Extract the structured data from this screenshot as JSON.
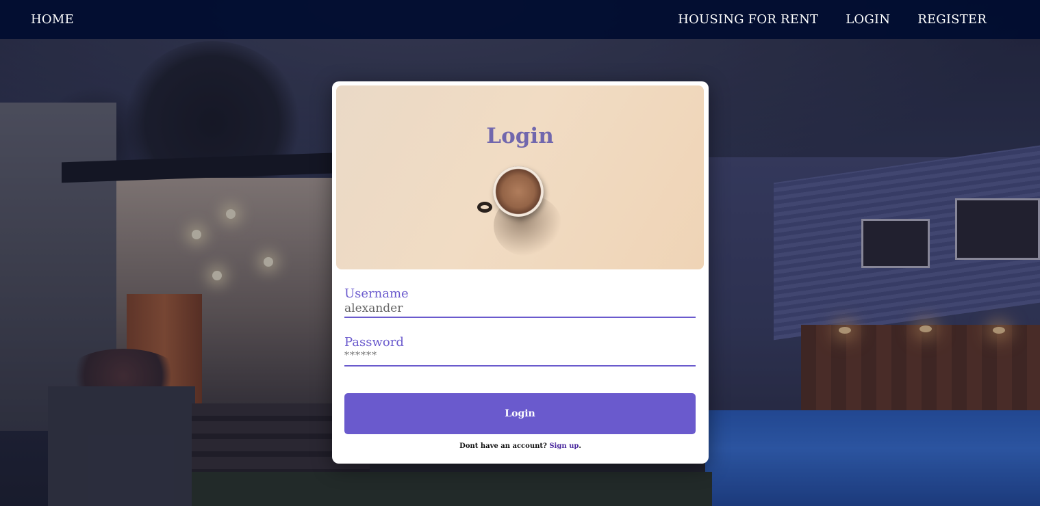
{
  "navbar": {
    "home": "HOME",
    "links": {
      "housing": "HOUSING FOR RENT",
      "login": "LOGIN",
      "register": "REGISTER"
    }
  },
  "login_card": {
    "title": "Login",
    "username": {
      "label": "Username",
      "value": "alexander"
    },
    "password": {
      "label": "Password",
      "value": "******"
    },
    "submit_label": "Login",
    "signup_prompt": "Dont have an account?",
    "signup_link": "Sign up",
    "signup_suffix": "."
  },
  "colors": {
    "navbar_bg": "#000c30",
    "accent": "#6a5acd",
    "title": "#7167ad"
  }
}
